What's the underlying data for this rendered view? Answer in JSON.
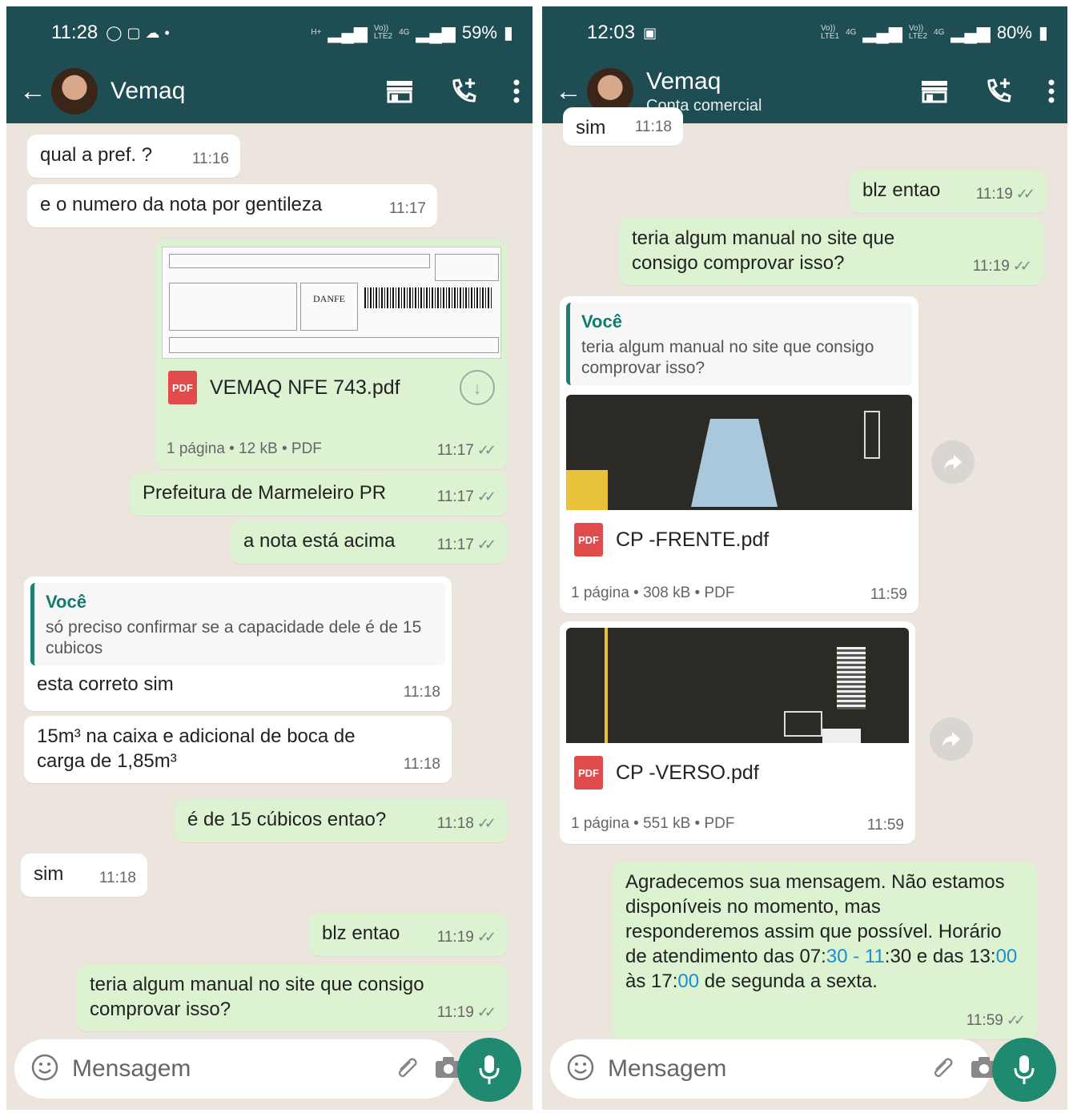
{
  "left": {
    "status": {
      "time": "11:28",
      "battery": "59%",
      "sig1": "H+",
      "volte": "Vo))\nLTE2",
      "sig2": "4G"
    },
    "contact": {
      "name": "Vemaq"
    },
    "messages": {
      "m1": {
        "text": "qual a pref. ?",
        "time": "11:16"
      },
      "m2": {
        "text": "e o numero da nota por gentileza",
        "time": "11:17"
      },
      "m3": {
        "file": "VEMAQ NFE 743.pdf",
        "info": "1 página • 12 kB • PDF",
        "time": "11:17",
        "pdf": "PDF",
        "thumb_title": "DANFE"
      },
      "m4": {
        "text": "Prefeitura de Marmeleiro PR",
        "time": "11:17"
      },
      "m5": {
        "text": "a nota está acima",
        "time": "11:17"
      },
      "m6": {
        "quote_author": "Você",
        "quote_text": "só preciso confirmar se a capacidade dele é de 15 cubicos",
        "text": "esta correto sim",
        "time": "11:18"
      },
      "m7": {
        "text": "15m³ na caixa e adicional de boca de carga de 1,85m³",
        "time": "11:18"
      },
      "m8": {
        "text": "é de 15 cúbicos entao?",
        "time": "11:18"
      },
      "m9": {
        "text": "sim",
        "time": "11:18"
      },
      "m10": {
        "text": "blz entao",
        "time": "11:19"
      },
      "m11": {
        "text": "teria algum manual no site que consigo comprovar isso?",
        "time": "11:19"
      }
    },
    "input_placeholder": "Mensagem"
  },
  "right": {
    "status": {
      "time": "12:03",
      "battery": "80%",
      "volte1": "Vo))\nLTE1",
      "sig1": "4G",
      "volte2": "Vo))\nLTE2",
      "sig2": "4G"
    },
    "contact": {
      "name": "Vemaq",
      "subtitle": "Conta comercial"
    },
    "messages": {
      "m0": {
        "text": "sim",
        "time": "11:18"
      },
      "m1": {
        "text": "blz entao",
        "time": "11:19"
      },
      "m2": {
        "text": "teria algum manual no site que consigo comprovar isso?",
        "time": "11:19"
      },
      "m3": {
        "quote_author": "Você",
        "quote_text": "teria algum manual no site que consigo comprovar isso?",
        "file": "CP -FRENTE.pdf",
        "info": "1 página • 308 kB • PDF",
        "time": "11:59",
        "pdf": "PDF"
      },
      "m4": {
        "file": "CP -VERSO.pdf",
        "info": "1 página • 551 kB • PDF",
        "time": "11:59",
        "pdf": "PDF"
      },
      "m5": {
        "text_a": "Agradecemos sua mensagem. Não estamos disponíveis no momento, mas responderemos assim que possível. Horário de atendimento das 07:",
        "h1": "30 - 11",
        "text_b": ":30 e das 13:",
        "h2": "00",
        "text_c": " às 17:",
        "h3": "00",
        "text_d": " de segunda a sexta.",
        "time": "11:59"
      }
    },
    "input_placeholder": "Mensagem"
  },
  "colors": {
    "header": "#1f4d54",
    "chat_bg": "#ece5dd",
    "outgoing": "#dcf2d0",
    "incoming": "#ffffff",
    "accent": "#1f8a70",
    "link": "#1a8fd3"
  }
}
